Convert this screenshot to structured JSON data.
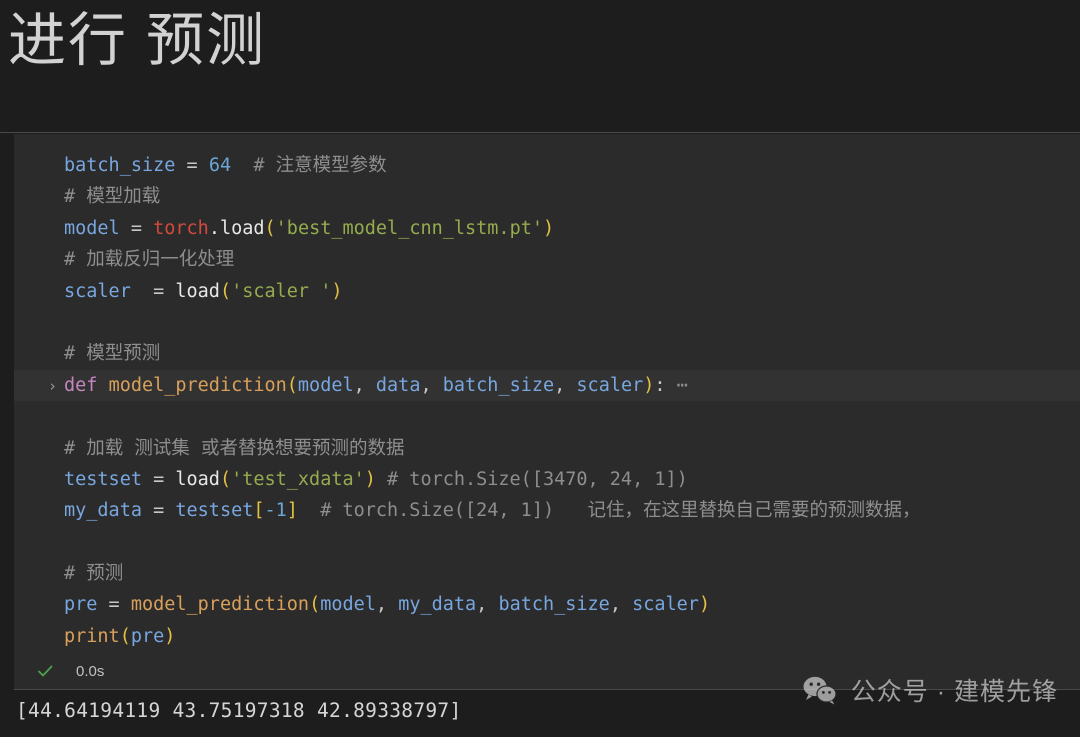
{
  "header": {
    "title": "进行 预测"
  },
  "colors": {
    "page_background": "#1d1d1d",
    "code_background": "#2b2b2b",
    "folded_line_background": "#323232",
    "variable": "#78a6df",
    "number": "#6aa6d6",
    "comment": "#8e8e8e",
    "class_name": "#d14b3d",
    "bracket": "#e2c044",
    "string": "#94ab4e",
    "keyword": "#c586c0",
    "function": "#d9a05b",
    "success_check": "#4aa34a",
    "title_text": "#d2d2d2"
  },
  "code_cell": {
    "collapse_chevron": "chevron-left-icon",
    "fold_arrow": "›",
    "fold_ellipsis": "⋯",
    "lines": [
      {
        "id": "line-batch-size",
        "tokens": [
          {
            "t": "batch_size",
            "c": "tok-var"
          },
          {
            "t": " = ",
            "c": "tok-op"
          },
          {
            "t": "64",
            "c": "tok-num"
          },
          {
            "t": "  # 注意模型参数",
            "c": "tok-comment"
          }
        ]
      },
      {
        "id": "line-comment-model-load",
        "tokens": [
          {
            "t": "# 模型加载",
            "c": "tok-comment"
          }
        ]
      },
      {
        "id": "line-model-load",
        "tokens": [
          {
            "t": "model",
            "c": "tok-var"
          },
          {
            "t": " = ",
            "c": "tok-op"
          },
          {
            "t": "torch",
            "c": "tok-class"
          },
          {
            "t": ".",
            "c": "tok-fn-white"
          },
          {
            "t": "load",
            "c": "tok-fn-white"
          },
          {
            "t": "(",
            "c": "tok-paren"
          },
          {
            "t": "'best_model_cnn_lstm.pt'",
            "c": "tok-str"
          },
          {
            "t": ")",
            "c": "tok-paren"
          }
        ]
      },
      {
        "id": "line-comment-inverse-norm",
        "tokens": [
          {
            "t": "# 加载反归一化处理",
            "c": "tok-comment"
          }
        ]
      },
      {
        "id": "line-scaler",
        "tokens": [
          {
            "t": "scaler",
            "c": "tok-var"
          },
          {
            "t": "  = ",
            "c": "tok-op"
          },
          {
            "t": "load",
            "c": "tok-fn-white"
          },
          {
            "t": "(",
            "c": "tok-paren"
          },
          {
            "t": "'scaler '",
            "c": "tok-str"
          },
          {
            "t": ")",
            "c": "tok-paren"
          }
        ]
      },
      {
        "id": "line-blank-1",
        "tokens": [
          {
            "t": " ",
            "c": "tok-op"
          }
        ]
      },
      {
        "id": "line-comment-predict",
        "tokens": [
          {
            "t": "# 模型预测",
            "c": "tok-comment"
          }
        ]
      },
      {
        "id": "line-def-model-prediction",
        "folded": true,
        "tokens": [
          {
            "t": "def",
            "c": "tok-kw"
          },
          {
            "t": " ",
            "c": "tok-op"
          },
          {
            "t": "model_prediction",
            "c": "tok-fn"
          },
          {
            "t": "(",
            "c": "tok-paren"
          },
          {
            "t": "model",
            "c": "tok-var"
          },
          {
            "t": ", ",
            "c": "tok-op"
          },
          {
            "t": "data",
            "c": "tok-var"
          },
          {
            "t": ", ",
            "c": "tok-op"
          },
          {
            "t": "batch_size",
            "c": "tok-var"
          },
          {
            "t": ", ",
            "c": "tok-op"
          },
          {
            "t": "scaler",
            "c": "tok-var"
          },
          {
            "t": ")",
            "c": "tok-paren"
          },
          {
            "t": ":",
            "c": "tok-op"
          },
          {
            "t": " ⋯",
            "c": "tok-ellipsis"
          }
        ]
      },
      {
        "id": "line-blank-2",
        "tokens": [
          {
            "t": " ",
            "c": "tok-op"
          }
        ]
      },
      {
        "id": "line-comment-load-testset",
        "tokens": [
          {
            "t": "# 加载 测试集 或者替换想要预测的数据",
            "c": "tok-comment"
          }
        ]
      },
      {
        "id": "line-testset",
        "tokens": [
          {
            "t": "testset",
            "c": "tok-var"
          },
          {
            "t": " = ",
            "c": "tok-op"
          },
          {
            "t": "load",
            "c": "tok-fn-white"
          },
          {
            "t": "(",
            "c": "tok-paren"
          },
          {
            "t": "'test_xdata'",
            "c": "tok-str"
          },
          {
            "t": ")",
            "c": "tok-paren"
          },
          {
            "t": " # torch.Size([3470, 24, 1])",
            "c": "tok-comment"
          }
        ]
      },
      {
        "id": "line-my-data",
        "tokens": [
          {
            "t": "my_data",
            "c": "tok-var"
          },
          {
            "t": " = ",
            "c": "tok-op"
          },
          {
            "t": "testset",
            "c": "tok-var"
          },
          {
            "t": "[",
            "c": "tok-paren"
          },
          {
            "t": "-1",
            "c": "tok-num"
          },
          {
            "t": "]",
            "c": "tok-paren"
          },
          {
            "t": "  # torch.Size([24, 1])   记住，在这里替换自己需要的预测数据，",
            "c": "tok-comment"
          }
        ]
      },
      {
        "id": "line-blank-3",
        "tokens": [
          {
            "t": " ",
            "c": "tok-op"
          }
        ]
      },
      {
        "id": "line-comment-pre",
        "tokens": [
          {
            "t": "# 预测",
            "c": "tok-comment"
          }
        ]
      },
      {
        "id": "line-pre-assign",
        "tokens": [
          {
            "t": "pre",
            "c": "tok-var"
          },
          {
            "t": " = ",
            "c": "tok-op"
          },
          {
            "t": "model_prediction",
            "c": "tok-fn"
          },
          {
            "t": "(",
            "c": "tok-paren"
          },
          {
            "t": "model",
            "c": "tok-var"
          },
          {
            "t": ", ",
            "c": "tok-op"
          },
          {
            "t": "my_data",
            "c": "tok-var"
          },
          {
            "t": ", ",
            "c": "tok-op"
          },
          {
            "t": "batch_size",
            "c": "tok-var"
          },
          {
            "t": ", ",
            "c": "tok-op"
          },
          {
            "t": "scaler",
            "c": "tok-var"
          },
          {
            "t": ")",
            "c": "tok-paren"
          }
        ]
      },
      {
        "id": "line-print",
        "tokens": [
          {
            "t": "print",
            "c": "tok-fn"
          },
          {
            "t": "(",
            "c": "tok-paren"
          },
          {
            "t": "pre",
            "c": "tok-var"
          },
          {
            "t": ")",
            "c": "tok-paren"
          }
        ]
      }
    ]
  },
  "execution": {
    "status_icon": "check-icon",
    "elapsed": "0.0s"
  },
  "output": {
    "text": "[44.64194119 43.75197318 42.89338797]"
  },
  "watermark": {
    "icon": "wechat-icon",
    "text": "公众号 · 建模先锋"
  }
}
